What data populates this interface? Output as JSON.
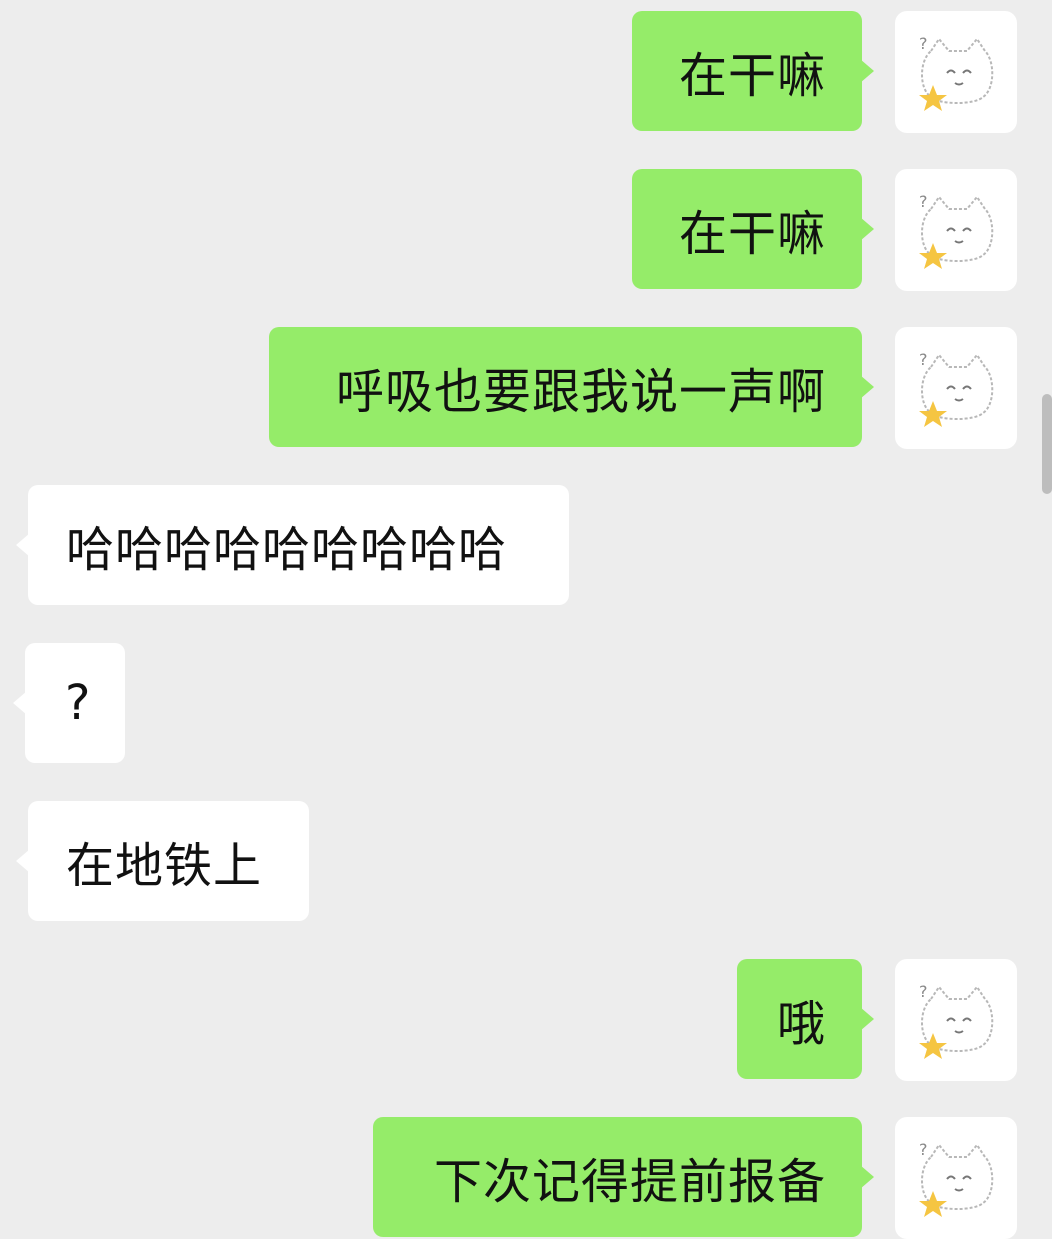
{
  "chat": {
    "messages": [
      {
        "sender": "me",
        "text": "在干嘛"
      },
      {
        "sender": "me",
        "text": "在干嘛"
      },
      {
        "sender": "me",
        "text": "呼吸也要跟我说一声啊"
      },
      {
        "sender": "other",
        "text": "哈哈哈哈哈哈哈哈哈"
      },
      {
        "sender": "other",
        "text": "?"
      },
      {
        "sender": "other",
        "text": "在地铁上"
      },
      {
        "sender": "me",
        "text": "哦"
      },
      {
        "sender": "me",
        "text": "下次记得提前报备"
      }
    ]
  },
  "colors": {
    "background": "#ededed",
    "outgoing_bubble": "#95ec69",
    "incoming_bubble": "#ffffff",
    "text": "#111111",
    "avatar_star": "#f5c542"
  },
  "icons": {
    "avatar": "white-cat-with-star-icon"
  }
}
